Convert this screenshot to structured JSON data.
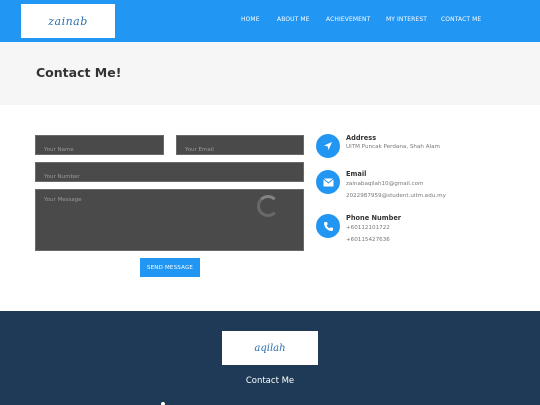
{
  "header": {
    "logo_text": "zainab",
    "nav": [
      {
        "label": "HOME"
      },
      {
        "label": "ABOUT ME"
      },
      {
        "label": "ACHIEVEMENT"
      },
      {
        "label": "MY INTEREST"
      },
      {
        "label": "CONTACT ME"
      }
    ]
  },
  "page": {
    "title": "Contact Me!"
  },
  "form": {
    "name_placeholder": "Your Name",
    "email_placeholder": "Your Email",
    "number_placeholder": "Your Number",
    "message_placeholder": "Your Message",
    "send_label": "SEND MESSAGE"
  },
  "contact": {
    "address": {
      "title": "Address",
      "lines": [
        "UiTM Puncak Perdana, Shah Alam"
      ],
      "icon": "location-arrow-icon"
    },
    "email": {
      "title": "Email",
      "lines": [
        "zainabaqilah10@gmail.com",
        "2022987959@student.uitm.edu.my"
      ],
      "icon": "envelope-icon"
    },
    "phone": {
      "title": "Phone Number",
      "lines": [
        "+60112101722",
        "+60115427636"
      ],
      "icon": "phone-icon"
    }
  },
  "footer": {
    "logo_text": "aqilah",
    "heading": "Contact Me"
  },
  "colors": {
    "accent": "#2196f3",
    "footer": "#1f3a56",
    "field": "#4a4a4a"
  }
}
